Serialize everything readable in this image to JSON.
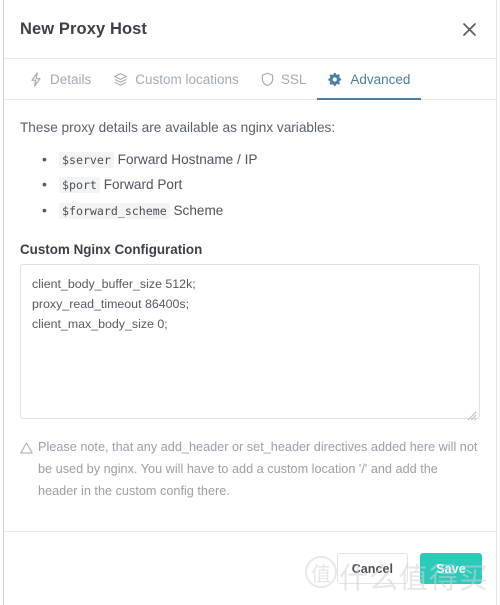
{
  "modal": {
    "title": "New Proxy Host",
    "close_icon": "close-icon"
  },
  "tabs": [
    {
      "label": "Details",
      "icon": "zap-icon",
      "active": false
    },
    {
      "label": "Custom locations",
      "icon": "layers-icon",
      "active": false
    },
    {
      "label": "SSL",
      "icon": "shield-icon",
      "active": false
    },
    {
      "label": "Advanced",
      "icon": "gear-icon",
      "active": true
    }
  ],
  "advanced": {
    "intro": "These proxy details are available as nginx variables:",
    "variables": [
      {
        "name": "$server",
        "description": "Forward Hostname / IP"
      },
      {
        "name": "$port",
        "description": "Forward Port"
      },
      {
        "name": "$forward_scheme",
        "description": "Scheme"
      }
    ],
    "config_label": "Custom Nginx Configuration",
    "config_value": "client_body_buffer_size 512k;\nproxy_read_timeout 86400s;\nclient_max_body_size 0;",
    "config_placeholder": "",
    "note_icon": "warning-triangle-icon",
    "note": "Please note, that any add_header or set_header directives added here will not be used by nginx. You will have to add a custom location '/' and add the header in the custom config there."
  },
  "footer": {
    "cancel_label": "Cancel",
    "save_label": "Save"
  },
  "watermark": {
    "mark": "值",
    "text": "什么值得买"
  },
  "colors": {
    "accent_active_tab": "#4a7fa0",
    "save_button": "#2bcbba",
    "muted_text": "#a4abb3",
    "border": "#e9ecef"
  }
}
